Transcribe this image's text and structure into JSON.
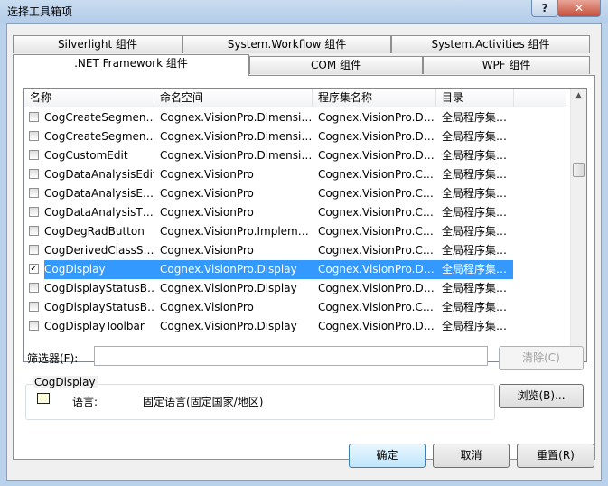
{
  "window": {
    "title": "选择工具箱项",
    "help_glyph": "?",
    "close_glyph": "✕"
  },
  "tabs": {
    "row_back": [
      "Silverlight 组件",
      "System.Workflow 组件",
      "System.Activities 组件"
    ],
    "row_front": [
      ".NET Framework 组件",
      "COM 组件",
      "WPF 组件"
    ],
    "active": ".NET Framework 组件"
  },
  "list": {
    "columns": [
      "名称",
      "命名空间",
      "程序集名称",
      "目录"
    ],
    "rows": [
      {
        "checked": false,
        "name": "CogCreateSegmen…",
        "namespace": "Cognex.VisionPro.Dimensi…",
        "assembly": "Cognex.VisionPro.D…",
        "dir": "全局程序集…"
      },
      {
        "checked": false,
        "name": "CogCreateSegmen…",
        "namespace": "Cognex.VisionPro.Dimensi…",
        "assembly": "Cognex.VisionPro.D…",
        "dir": "全局程序集…"
      },
      {
        "checked": false,
        "name": "CogCustomEdit",
        "namespace": "Cognex.VisionPro.Dimensi…",
        "assembly": "Cognex.VisionPro.D…",
        "dir": "全局程序集…"
      },
      {
        "checked": false,
        "name": "CogDataAnalysisEdit",
        "namespace": "Cognex.VisionPro",
        "assembly": "Cognex.VisionPro.C…",
        "dir": "全局程序集…"
      },
      {
        "checked": false,
        "name": "CogDataAnalysisE…",
        "namespace": "Cognex.VisionPro",
        "assembly": "Cognex.VisionPro.C…",
        "dir": "全局程序集…"
      },
      {
        "checked": false,
        "name": "CogDataAnalysisT…",
        "namespace": "Cognex.VisionPro",
        "assembly": "Cognex.VisionPro.C…",
        "dir": "全局程序集…"
      },
      {
        "checked": false,
        "name": "CogDegRadButton",
        "namespace": "Cognex.VisionPro.Implem…",
        "assembly": "Cognex.VisionPro.C…",
        "dir": "全局程序集…"
      },
      {
        "checked": false,
        "name": "CogDerivedClassS…",
        "namespace": "Cognex.VisionPro",
        "assembly": "Cognex.VisionPro.C…",
        "dir": "全局程序集…"
      },
      {
        "checked": true,
        "name": "CogDisplay",
        "namespace": "Cognex.VisionPro.Display",
        "assembly": "Cognex.VisionPro.D…",
        "dir": "全局程序集…",
        "selected": true
      },
      {
        "checked": false,
        "name": "CogDisplayStatusB…",
        "namespace": "Cognex.VisionPro.Display",
        "assembly": "Cognex.VisionPro.D…",
        "dir": "全局程序集…"
      },
      {
        "checked": false,
        "name": "CogDisplayStatusB…",
        "namespace": "Cognex.VisionPro",
        "assembly": "Cognex.VisionPro.C…",
        "dir": "全局程序集…"
      },
      {
        "checked": false,
        "name": "CogDisplayToolbar",
        "namespace": "Cognex.VisionPro.Display",
        "assembly": "Cognex.VisionPro.D…",
        "dir": "全局程序集…"
      }
    ]
  },
  "filter": {
    "label": "筛选器(F):",
    "value": "",
    "clear_label": "清除(C)"
  },
  "details": {
    "group_title": "CogDisplay",
    "language_label": "语言:",
    "language_value": "固定语言(固定国家/地区)",
    "browse_label": "浏览(B)..."
  },
  "buttons": {
    "ok": "确定",
    "cancel": "取消",
    "reset": "重置(R)"
  }
}
